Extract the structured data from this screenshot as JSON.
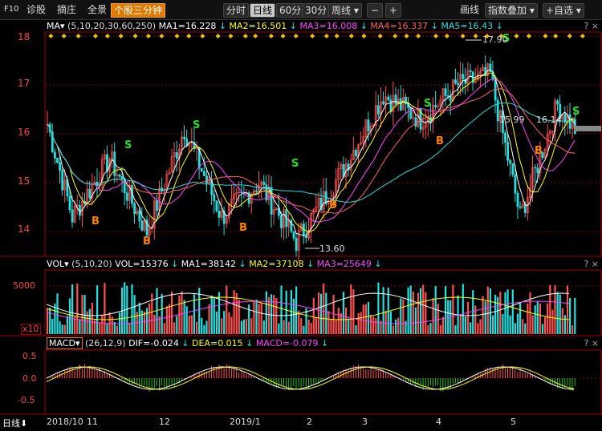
{
  "toolbar": {
    "items": [
      "F10",
      "诊股",
      "摘庄",
      "全景",
      "个股三分钟"
    ],
    "periods": [
      "分时",
      "日线",
      "60分",
      "30分"
    ],
    "week_label": "周线",
    "minus": "−",
    "plus": "+",
    "draw_label": "画线",
    "index_overlay": "指数叠加",
    "add_watch": "+自选"
  },
  "main_panel": {
    "indicator": "MA",
    "params": "(5,10,20,30,60,250)",
    "ma_values": [
      {
        "label": "MA1=16.228",
        "color": "#ffffff"
      },
      {
        "label": "MA2=16.501",
        "color": "#ffff00"
      },
      {
        "label": "MA3=16.008",
        "color": "#ff40ff"
      },
      {
        "label": "MA4=16.337",
        "color": "#ff6060"
      },
      {
        "label": "MA5=16.43",
        "color": "#20e0e0"
      }
    ],
    "y_ticks": [
      "18",
      "17",
      "16",
      "15",
      "14"
    ],
    "high_label": "17.90",
    "low_label": "13.60",
    "cursor_label": "15.99",
    "cursor_label2": "16.14",
    "signals": {
      "sell": "S",
      "buy": "B"
    }
  },
  "vol_panel": {
    "indicator": "VOL",
    "params": "(5,10,20)",
    "values": [
      {
        "label": "VOL=15376",
        "color": "#ffffff"
      },
      {
        "label": "MA1=38142",
        "color": "#ffffff"
      },
      {
        "label": "MA2=37108",
        "color": "#ffff00"
      },
      {
        "label": "MA3=25649",
        "color": "#ff40ff"
      }
    ],
    "y_tick": "5000",
    "unit": "x10"
  },
  "macd_panel": {
    "indicator": "MACD",
    "params": "(26,12,9)",
    "values": [
      {
        "label": "DIF=-0.024",
        "color": "#ffffff"
      },
      {
        "label": "DEA=0.015",
        "color": "#ffff00"
      },
      {
        "label": "MACD=-0.079",
        "color": "#ff40ff"
      }
    ],
    "y_ticks": [
      "0.5",
      "0.0",
      "-0.5"
    ]
  },
  "footer": {
    "period": "日线",
    "x_labels": [
      "2018/10",
      "11",
      "12",
      "2019/1",
      "2",
      "3",
      "4",
      "5"
    ]
  },
  "help_mark": "? ×",
  "colors": {
    "up": "#ff5050",
    "down": "#20e0e0",
    "grid": "#8b0000",
    "panel_border": "#a00000"
  }
}
